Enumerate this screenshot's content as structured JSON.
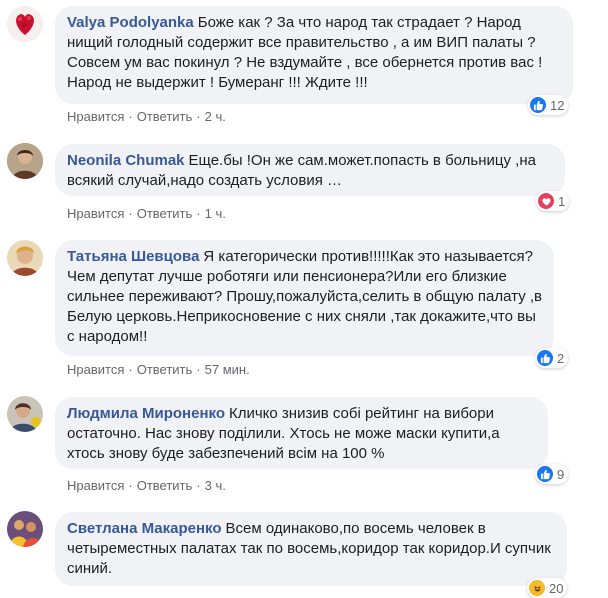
{
  "comments": [
    {
      "author": "Valya Podolyanka",
      "text": "Боже как ? За что народ так страдает ? Народ нищий голодный содержит все правительство , а им ВИП палаты ? Совсем ум вас покинул ? Не вздумайте , все обернется против вас ! Народ не выдержит ! Бумеранг !!! Ждите !!!",
      "like_label": "Нравится",
      "reply_label": "Ответить",
      "time": "2 ч.",
      "reaction": "like",
      "reaction_count": "12"
    },
    {
      "author": "Neonila Chumak",
      "text": "Еще.бы !Он же сам.может.попасть в больницу ,на всякий случай,надо создать условия …",
      "like_label": "Нравится",
      "reply_label": "Ответить",
      "time": "1 ч.",
      "reaction": "love",
      "reaction_count": "1"
    },
    {
      "author": "Татьяна Шевцова",
      "text": "Я категорически против!!!!!Как это называется?Чем депутат лучше роботяги или пенсионера?Или его близкие сильнее переживают? Прошу,пожалуйста,селить в общую палату ,в Белую церковь.Неприкосновение с них сняли ,так докажите,что вы с народом!!",
      "like_label": "Нравится",
      "reply_label": "Ответить",
      "time": "57 мин.",
      "reaction": "like",
      "reaction_count": "2"
    },
    {
      "author": "Людмила Мироненко",
      "text": "Кличко знизив собі рейтинг на вибори остаточно. Нас знову поділили. Хтось не може маски купити,а хтось знову буде забезпечений всім на 100 %",
      "like_label": "Нравится",
      "reply_label": "Ответить",
      "time": "3 ч.",
      "reaction": "like",
      "reaction_count": "9"
    },
    {
      "author": "Светлана Макаренко",
      "text": "Всем одинаково,по восемь человек в четыреместных палатах так по восемь,коридор так коридор.И супчик синий.",
      "reaction": "haha",
      "reaction_count": "20"
    }
  ],
  "colors": {
    "author": "#385898",
    "bubble": "#f0f2f5",
    "like": "#1877f2",
    "love": "#e4405f",
    "haha": "#f7b928"
  }
}
